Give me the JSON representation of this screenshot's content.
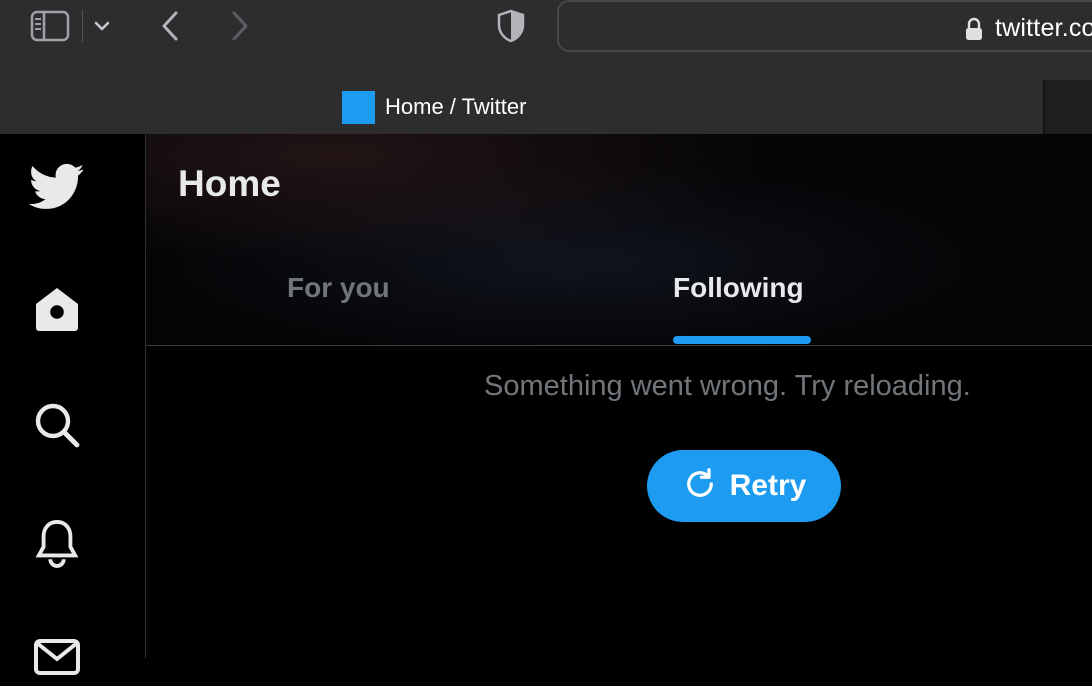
{
  "browser": {
    "url": "twitter.com",
    "tab": {
      "title": "Home / Twitter"
    }
  },
  "sidebar": {
    "items": [
      {
        "icon": "twitter-bird-icon"
      },
      {
        "icon": "home-icon"
      },
      {
        "icon": "search-icon"
      },
      {
        "icon": "bell-icon"
      },
      {
        "icon": "mail-icon"
      }
    ]
  },
  "main": {
    "title": "Home",
    "tabs": [
      {
        "label": "For you",
        "active": false
      },
      {
        "label": "Following",
        "active": true
      }
    ],
    "error": {
      "message": "Something went wrong. Try reloading.",
      "retry_label": "Retry"
    }
  },
  "colors": {
    "accent": "#1d9bf0",
    "background": "#000000",
    "muted_text": "#71767b",
    "chrome": "#2d2d2f"
  }
}
